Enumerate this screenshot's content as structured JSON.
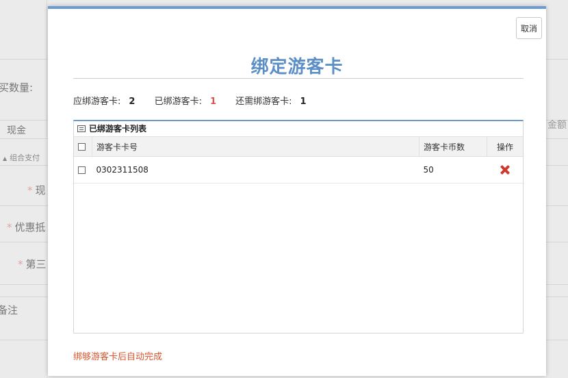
{
  "background": {
    "quantity_label": "买数量:",
    "cash_label": "现金",
    "combo_pay_label": "组合支付",
    "cash_field_label": "现",
    "discount_label": "优惠抵",
    "third_party_label": "第三",
    "remark_label": "备注",
    "amount_label": "金额"
  },
  "modal": {
    "cancel_label": "取消",
    "title": "绑定游客卡",
    "summary": {
      "should_label": "应绑游客卡:",
      "should_value": "2",
      "bound_label": "已绑游客卡:",
      "bound_value": "1",
      "remaining_label": "还需绑游客卡:",
      "remaining_value": "1"
    },
    "panel_title": "已绑游客卡列表",
    "table": {
      "columns": [
        "游客卡卡号",
        "游客卡币数",
        "操作"
      ],
      "rows": [
        {
          "card_no": "0302311508",
          "coins": "50"
        }
      ]
    },
    "footer_note": "绑够游客卡后自动完成"
  },
  "colors": {
    "accent": "#5d8fc7",
    "danger": "#d9534f",
    "delete_icon": "#cc3a2f",
    "note": "#d9552f"
  }
}
